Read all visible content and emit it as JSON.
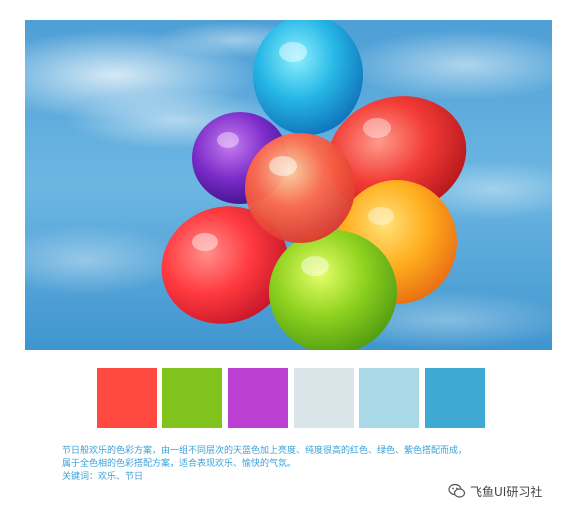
{
  "image": {
    "subject": "balloons-against-sky",
    "icon": "balloon-photo"
  },
  "palette": {
    "colors": [
      "#ff4a42",
      "#7fc31c",
      "#bb3fd0",
      "#d9e5e8",
      "#a9d9e6",
      "#3ea9d3"
    ]
  },
  "caption": {
    "line1": "节日般欢乐的色彩方案，由一组不同层次的天蓝色加上亮度、纯度很高的红色、绿色、紫色搭配而成，",
    "line2": "属于全色相的色彩搭配方案，适合表现欢乐、愉快的气氛。",
    "keywords": "关键词：欢乐、节日"
  },
  "watermark": {
    "text": "飞鱼UI研习社",
    "icon": "wechat-icon"
  }
}
